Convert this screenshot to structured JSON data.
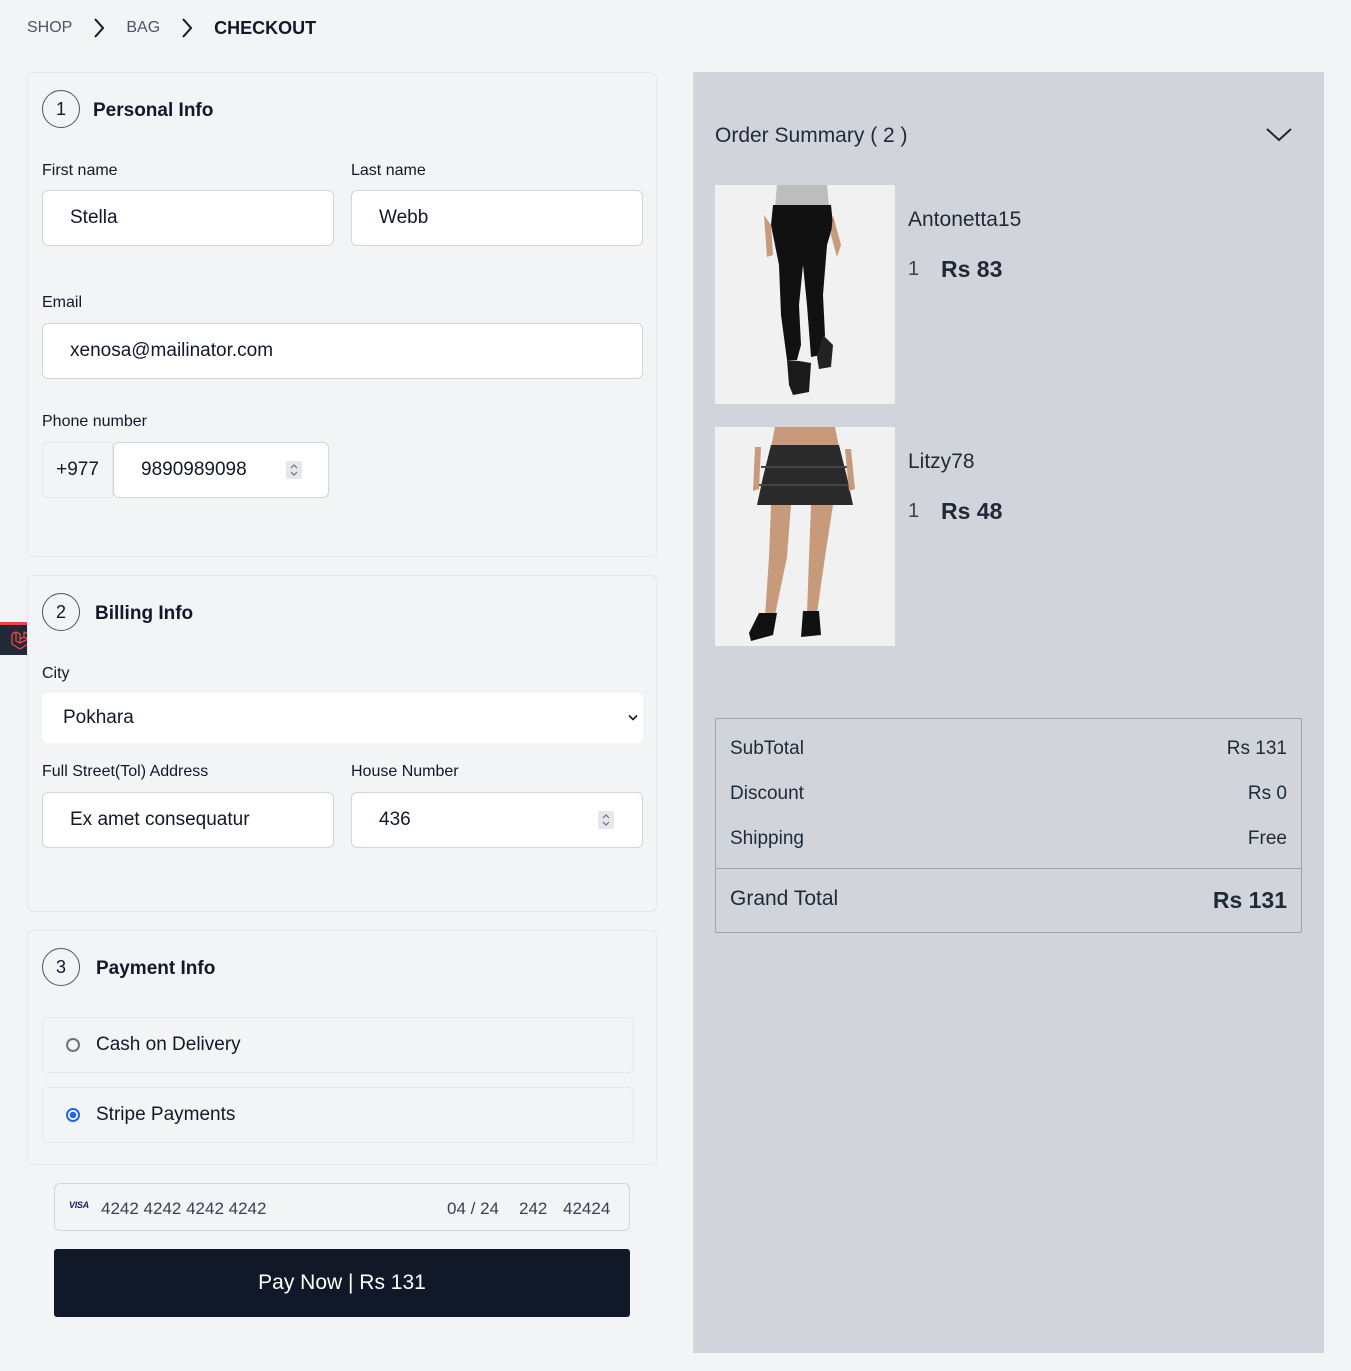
{
  "breadcrumb": {
    "shop": "SHOP",
    "bag": "BAG",
    "checkout": "CHECKOUT"
  },
  "personal": {
    "step": "1",
    "title": "Personal Info",
    "first_name_label": "First name",
    "first_name_value": "Stella",
    "last_name_label": "Last name",
    "last_name_value": "Webb",
    "email_label": "Email",
    "email_value": "xenosa@mailinator.com",
    "phone_label": "Phone number",
    "phone_prefix": "+977",
    "phone_value": "9890989098"
  },
  "billing": {
    "step": "2",
    "title": "Billing Info",
    "city_label": "City",
    "city_value": "Pokhara",
    "street_label": "Full Street(Tol) Address",
    "street_value": "Ex amet consequatur",
    "house_label": "House Number",
    "house_value": "436"
  },
  "payment": {
    "step": "3",
    "title": "Payment Info",
    "options": [
      {
        "label": "Cash on Delivery",
        "selected": false
      },
      {
        "label": "Stripe Payments",
        "selected": true
      }
    ],
    "card": {
      "brand": "VISA",
      "number": "4242 4242 4242 4242",
      "expiry": "04 / 24",
      "cvc": "242",
      "zip": "42424"
    },
    "pay_button": "Pay Now | Rs 131"
  },
  "summary": {
    "title": "Order Summary ( 2 )",
    "items": [
      {
        "name": "Antonetta15",
        "qty": "1",
        "price": "Rs 83",
        "image": "black-leggings-photo"
      },
      {
        "name": "Litzy78",
        "qty": "1",
        "price": "Rs 48",
        "image": "black-skirt-photo"
      }
    ],
    "subtotal_label": "SubTotal",
    "subtotal_value": "Rs 131",
    "discount_label": "Discount",
    "discount_value": "Rs 0",
    "shipping_label": "Shipping",
    "shipping_value": "Free",
    "grand_label": "Grand Total",
    "grand_value": "Rs 131"
  },
  "colors": {
    "accent": "#2563eb",
    "button": "#111827",
    "summary_bg": "#d1d5db",
    "page_bg": "#f3f4f6"
  }
}
